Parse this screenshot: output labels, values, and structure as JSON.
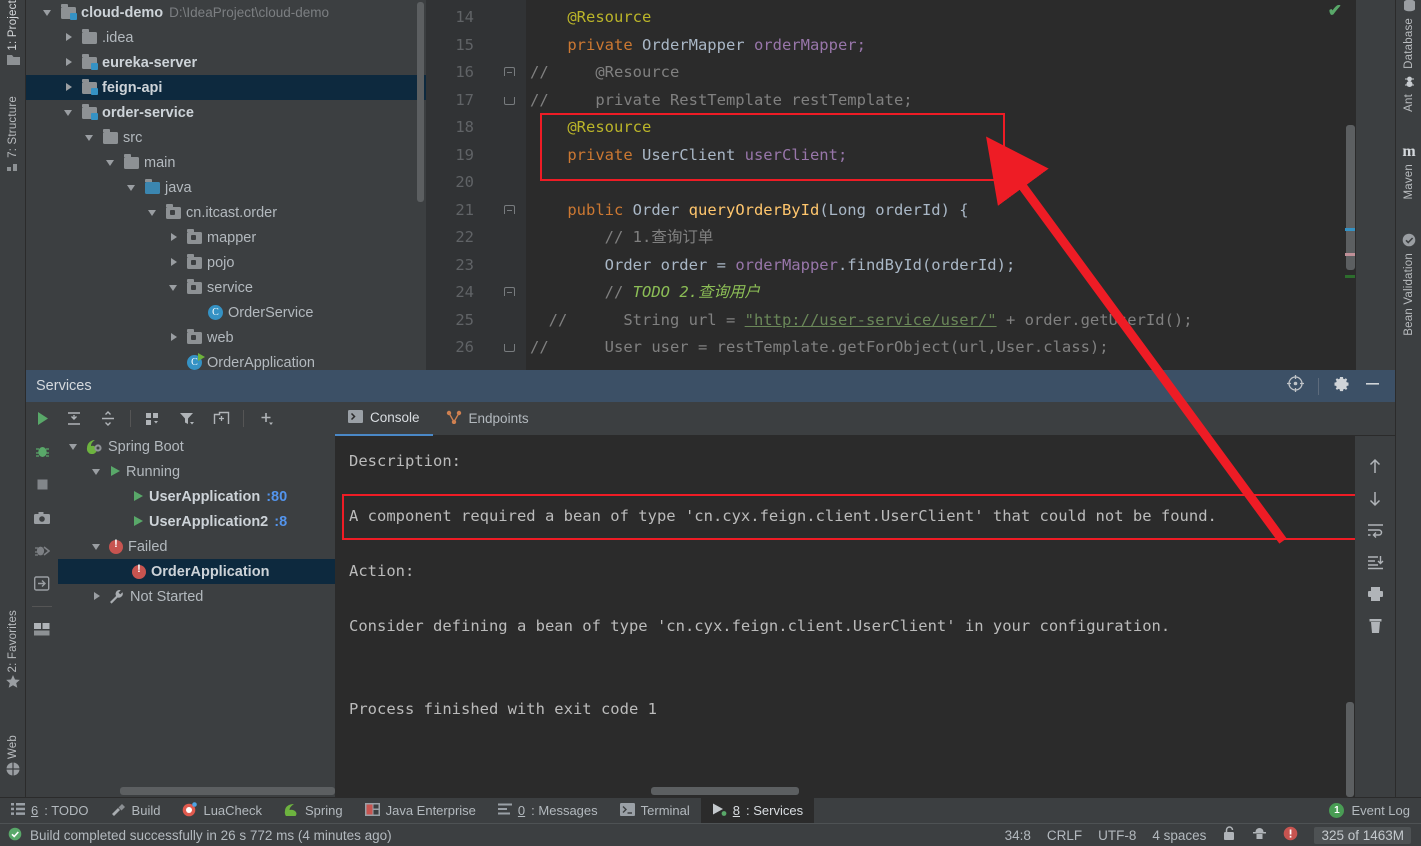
{
  "left_tool_tabs": [
    {
      "label": "1: Project",
      "icon": "folder-icon",
      "selected": true
    },
    {
      "label": "7: Structure",
      "icon": "structure-icon",
      "selected": false
    },
    {
      "label": "2: Favorites",
      "icon": "star-icon",
      "selected": false
    },
    {
      "label": "Web",
      "icon": "globe-icon",
      "selected": false
    }
  ],
  "right_tool_tabs": [
    {
      "label": "Database",
      "icon": "database-icon"
    },
    {
      "label": "Ant",
      "icon": "ant-icon"
    },
    {
      "label": "Maven",
      "icon": "maven-icon"
    },
    {
      "label": "Bean Validation",
      "icon": "bean-validation-icon"
    }
  ],
  "project_tree": [
    {
      "indent": 0,
      "arrow": "down",
      "icon": "module-folder",
      "label": "cloud-demo",
      "bold": true,
      "path": "D:\\IdeaProject\\cloud-demo",
      "selected": false
    },
    {
      "indent": 1,
      "arrow": "right",
      "icon": "folder",
      "label": ".idea",
      "bold": false,
      "path": "",
      "selected": false
    },
    {
      "indent": 1,
      "arrow": "right",
      "icon": "module-folder",
      "label": "eureka-server",
      "bold": true,
      "path": "",
      "selected": false
    },
    {
      "indent": 1,
      "arrow": "right",
      "icon": "module-folder",
      "label": "feign-api",
      "bold": true,
      "path": "",
      "selected": true
    },
    {
      "indent": 1,
      "arrow": "down",
      "icon": "module-folder",
      "label": "order-service",
      "bold": true,
      "path": "",
      "selected": false
    },
    {
      "indent": 2,
      "arrow": "down",
      "icon": "folder",
      "label": "src",
      "bold": false,
      "path": "",
      "selected": false
    },
    {
      "indent": 3,
      "arrow": "down",
      "icon": "folder",
      "label": "main",
      "bold": false,
      "path": "",
      "selected": false
    },
    {
      "indent": 4,
      "arrow": "down",
      "icon": "source-folder",
      "label": "java",
      "bold": false,
      "path": "",
      "selected": false
    },
    {
      "indent": 5,
      "arrow": "down",
      "icon": "package",
      "label": "cn.itcast.order",
      "bold": false,
      "path": "",
      "selected": false
    },
    {
      "indent": 6,
      "arrow": "right",
      "icon": "package",
      "label": "mapper",
      "bold": false,
      "path": "",
      "selected": false
    },
    {
      "indent": 6,
      "arrow": "right",
      "icon": "package",
      "label": "pojo",
      "bold": false,
      "path": "",
      "selected": false
    },
    {
      "indent": 6,
      "arrow": "down",
      "icon": "package",
      "label": "service",
      "bold": false,
      "path": "",
      "selected": false
    },
    {
      "indent": 7,
      "arrow": "none",
      "icon": "class",
      "label": "OrderService",
      "bold": false,
      "path": "",
      "selected": false
    },
    {
      "indent": 6,
      "arrow": "right",
      "icon": "package",
      "label": "web",
      "bold": false,
      "path": "",
      "selected": false
    },
    {
      "indent": 6,
      "arrow": "none",
      "icon": "runnable-class",
      "label": "OrderApplication",
      "bold": false,
      "path": "",
      "selected": false
    }
  ],
  "editor": {
    "lines": [
      {
        "num": "14",
        "fold": "none",
        "tokens": [
          {
            "t": "@Resource",
            "c": "k-ann",
            "indent": 4
          }
        ]
      },
      {
        "num": "15",
        "fold": "none",
        "tokens": [
          {
            "t": "private ",
            "c": "k-kw",
            "indent": 4
          },
          {
            "t": "OrderMapper ",
            "c": "k-type"
          },
          {
            "t": "orderMapper;",
            "c": "k-field"
          }
        ]
      },
      {
        "num": "16",
        "fold": "start",
        "tokens": [
          {
            "t": "//     @Resource",
            "c": "k-comment",
            "indent": 0
          }
        ]
      },
      {
        "num": "17",
        "fold": "end",
        "tokens": [
          {
            "t": "//     private RestTemplate restTemplate;",
            "c": "k-comment",
            "indent": 0
          }
        ]
      },
      {
        "num": "18",
        "fold": "none",
        "tokens": [
          {
            "t": "@Resource",
            "c": "k-ann",
            "indent": 4
          }
        ]
      },
      {
        "num": "19",
        "fold": "none",
        "tokens": [
          {
            "t": "private ",
            "c": "k-kw",
            "indent": 4
          },
          {
            "t": "UserClient ",
            "c": "k-type"
          },
          {
            "t": "userClient;",
            "c": "k-field"
          }
        ]
      },
      {
        "num": "20",
        "fold": "none",
        "tokens": []
      },
      {
        "num": "21",
        "fold": "start",
        "tokens": [
          {
            "t": "public ",
            "c": "k-kw",
            "indent": 4
          },
          {
            "t": "Order ",
            "c": "k-type"
          },
          {
            "t": "queryOrderById",
            "c": "k-method"
          },
          {
            "t": "(Long orderId) {",
            "c": "k-plain"
          }
        ]
      },
      {
        "num": "22",
        "fold": "none",
        "tokens": [
          {
            "t": "// 1.查询订单",
            "c": "k-comment",
            "indent": 8
          }
        ]
      },
      {
        "num": "23",
        "fold": "none",
        "tokens": [
          {
            "t": "Order order = ",
            "c": "k-plain",
            "indent": 8
          },
          {
            "t": "orderMapper",
            "c": "k-field"
          },
          {
            "t": ".findById(orderId);",
            "c": "k-plain"
          }
        ]
      },
      {
        "num": "24",
        "fold": "start",
        "tokens": [
          {
            "t": "// ",
            "c": "k-comment",
            "indent": 8
          },
          {
            "t": "TODO 2.查询用户",
            "c": "k-todo"
          }
        ]
      },
      {
        "num": "25",
        "fold": "none",
        "tokens": [
          {
            "t": "//      String url = ",
            "c": "k-comment",
            "indent": 2
          },
          {
            "t": "\"http://user-service/user/\"",
            "c": "k-link"
          },
          {
            "t": " + order.getUserId();",
            "c": "k-comment"
          }
        ]
      },
      {
        "num": "26",
        "fold": "end",
        "tokens": [
          {
            "t": "//      User user = restTemplate.getForObject(url,User.class);",
            "c": "k-comment",
            "indent": 0
          }
        ]
      }
    ],
    "highlight_border_color": "#ee1c25"
  },
  "services": {
    "title": "Services",
    "header_icons": [
      {
        "name": "locate-icon"
      },
      {
        "name": "gear-icon"
      },
      {
        "name": "minimize-icon"
      }
    ],
    "left_toolbar_icons": [
      {
        "name": "run-icon"
      },
      {
        "name": "debug-icon"
      },
      {
        "name": "stop-icon"
      },
      {
        "name": "camera-icon"
      },
      {
        "name": "attach-debugger-icon"
      },
      {
        "name": "import-icon"
      },
      {
        "name": "layout-icon"
      }
    ],
    "top_toolbar_icons": [
      {
        "name": "expand-all-icon"
      },
      {
        "name": "collapse-all-icon"
      },
      {
        "name": "group-by-icon"
      },
      {
        "name": "filter-icon"
      },
      {
        "name": "add-tab-icon"
      },
      {
        "name": "add-icon"
      }
    ],
    "tree": [
      {
        "indent": 0,
        "arrow": "down",
        "icon": "spring-boot-icon",
        "label": "Spring Boot",
        "bold": false,
        "port": "",
        "selected": false
      },
      {
        "indent": 1,
        "arrow": "down",
        "icon": "run-icon",
        "label": "Running",
        "bold": false,
        "port": "",
        "selected": false
      },
      {
        "indent": 2,
        "arrow": "none",
        "icon": "run-icon",
        "label": "UserApplication",
        "bold": true,
        "port": ":80",
        "selected": false
      },
      {
        "indent": 2,
        "arrow": "none",
        "icon": "run-icon",
        "label": "UserApplication2",
        "bold": true,
        "port": ":8",
        "selected": false
      },
      {
        "indent": 1,
        "arrow": "down",
        "icon": "error-icon",
        "label": "Failed",
        "bold": false,
        "port": "",
        "selected": false
      },
      {
        "indent": 2,
        "arrow": "none",
        "icon": "error-icon",
        "label": "OrderApplication",
        "bold": true,
        "port": "",
        "selected": true
      },
      {
        "indent": 1,
        "arrow": "right",
        "icon": "wrench-icon",
        "label": "Not Started",
        "bold": false,
        "port": "",
        "selected": false
      }
    ],
    "console_tabs": [
      {
        "label": "Console",
        "icon": "console-icon",
        "active": true
      },
      {
        "label": "Endpoints",
        "icon": "endpoints-icon",
        "active": false
      }
    ],
    "console_output": {
      "description_label": "Description:",
      "error_message": "A component required a bean of type 'cn.cyx.feign.client.UserClient' that could not be found.",
      "action_label": "Action:",
      "action_message": "Consider defining a bean of type 'cn.cyx.feign.client.UserClient' in your configuration.",
      "process_message": "Process finished with exit code 1"
    },
    "right_toolbar_icons": [
      {
        "name": "scroll-up-icon"
      },
      {
        "name": "scroll-down-icon"
      },
      {
        "name": "soft-wrap-icon"
      },
      {
        "name": "scroll-to-end-icon"
      },
      {
        "name": "print-icon"
      },
      {
        "name": "trash-icon"
      }
    ]
  },
  "bottom_tabs": [
    {
      "label_prefix": "6",
      "label": ": TODO",
      "icon": "todo-icon",
      "active": false
    },
    {
      "label_prefix": "",
      "label": "Build",
      "icon": "build-icon",
      "active": false
    },
    {
      "label_prefix": "",
      "label": "LuaCheck",
      "icon": "luacheck-icon",
      "active": false
    },
    {
      "label_prefix": "",
      "label": "Spring",
      "icon": "spring-icon",
      "active": false
    },
    {
      "label_prefix": "",
      "label": "Java Enterprise",
      "icon": "java-enterprise-icon",
      "active": false
    },
    {
      "label_prefix": "0",
      "label": ": Messages",
      "icon": "messages-icon",
      "active": false
    },
    {
      "label_prefix": "",
      "label": "Terminal",
      "icon": "terminal-icon",
      "active": false
    },
    {
      "label_prefix": "8",
      "label": ": Services",
      "icon": "services-icon",
      "active": true
    }
  ],
  "event_log": {
    "count": "1",
    "label": "Event Log"
  },
  "status_bar": {
    "build_message": "Build completed successfully in 26 s 772 ms (4 minutes ago)",
    "caret_position": "34:8",
    "line_separator": "CRLF",
    "encoding": "UTF-8",
    "indent": "4 spaces",
    "lock_icon": "unlocked-icon",
    "inspector_icon": "hector-icon",
    "error_icon": "error-icon",
    "memory": "325 of 1463M"
  },
  "colors": {
    "accent_blue": "#3592c4",
    "selection": "#0d293e",
    "error_red": "#c75450",
    "highlight_red": "#ee1c25",
    "green": "#59a869",
    "editor_bg": "#2b2b2b",
    "panel_bg": "#3c3f41"
  }
}
